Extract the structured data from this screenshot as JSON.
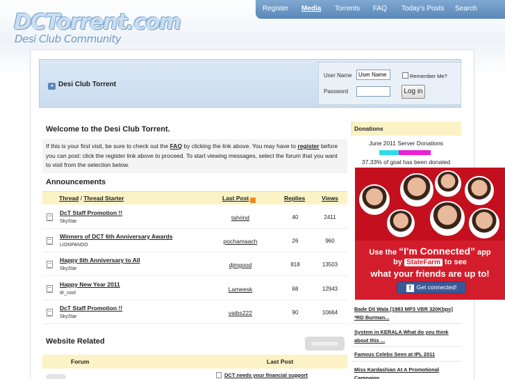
{
  "logo": {
    "main": "DCTorrent.com",
    "sub": "Desi Club Community"
  },
  "topnav": [
    {
      "label": "Register",
      "active": false
    },
    {
      "label": "Media",
      "active": true
    },
    {
      "label": "Torrents",
      "active": false
    },
    {
      "label": "FAQ",
      "active": false
    },
    {
      "label": "Today's Posts",
      "active": false
    },
    {
      "label": "Search",
      "active": false
    }
  ],
  "header": {
    "navbit": "Desi Club Torrent"
  },
  "login": {
    "username_label": "User Name",
    "username_value": "User Name",
    "password_label": "Password",
    "remember_label": "Remember Me?",
    "button": "Log in"
  },
  "welcome": {
    "title": "Welcome to the Desi Club Torrent.",
    "text_1": "If this is your first visit, be sure to check out the ",
    "faq": "FAQ",
    "text_2": " by clicking the link above. You may have to ",
    "register": "register",
    "text_3": " before you can post: click the register link above to proceed. To start viewing messages, select the forum that you want to visit from the selection below."
  },
  "announcements": {
    "title": "Announcements",
    "col_thread": "Thread",
    "col_sep": " / ",
    "col_starter": "Thread Starter",
    "col_lastpost": "Last Post",
    "col_replies": "Replies",
    "col_views": "Views",
    "rows": [
      {
        "title": "DcT Staff Promotion !!",
        "starter": "SkyStar",
        "lastpost": "tahrind",
        "replies": "40",
        "views": "2411"
      },
      {
        "title": "Winners of DCT 6th Anniversary Awards",
        "starter": "LIONPANDO",
        "lastpost": "pochamaach",
        "replies": "26",
        "views": "960"
      },
      {
        "title": "Happy 6th Anniversary to All",
        "starter": "SkyStar",
        "lastpost": "djmgood",
        "replies": "818",
        "views": "13503"
      },
      {
        "title": "Happy New Year 2011",
        "starter": "dr_cool",
        "lastpost": "Lameesk",
        "replies": "68",
        "views": "12943"
      },
      {
        "title": "DcT Staff Promotion !!",
        "starter": "SkyStar",
        "lastpost": "vaibs222",
        "replies": "90",
        "views": "10664"
      }
    ]
  },
  "website": {
    "title": "Website Related",
    "minimize": "minimize",
    "col_forum": "Forum",
    "col_lastpost": "Last Post",
    "first_lastpost": "DCT needs your financial support"
  },
  "donations": {
    "title": "Donations",
    "subtitle": "June 2011 Server Donations",
    "progress_fraction": 0.3733,
    "goal_text": "37.33% of goal has been donated"
  },
  "ad": {
    "line1_prefix": "Use the ",
    "line1_big": "“I'm Connected”",
    "line1_suffix": " app",
    "line2_prefix": "by ",
    "brand": "StateFarm",
    "line2_suffix": " to see",
    "line3": "what your friends are up to!",
    "button": "Get connected!",
    "fb_glyph": "f"
  },
  "side_links": [
    "Bade Dil Wala [1983 MP3 VBR 320Kbps] *RD Burman...",
    "System in KERALA What do you think about this ...",
    "Famous Celebs Seen at IPL 2011",
    "Miss Kardashian At A Promotional Campaign"
  ]
}
